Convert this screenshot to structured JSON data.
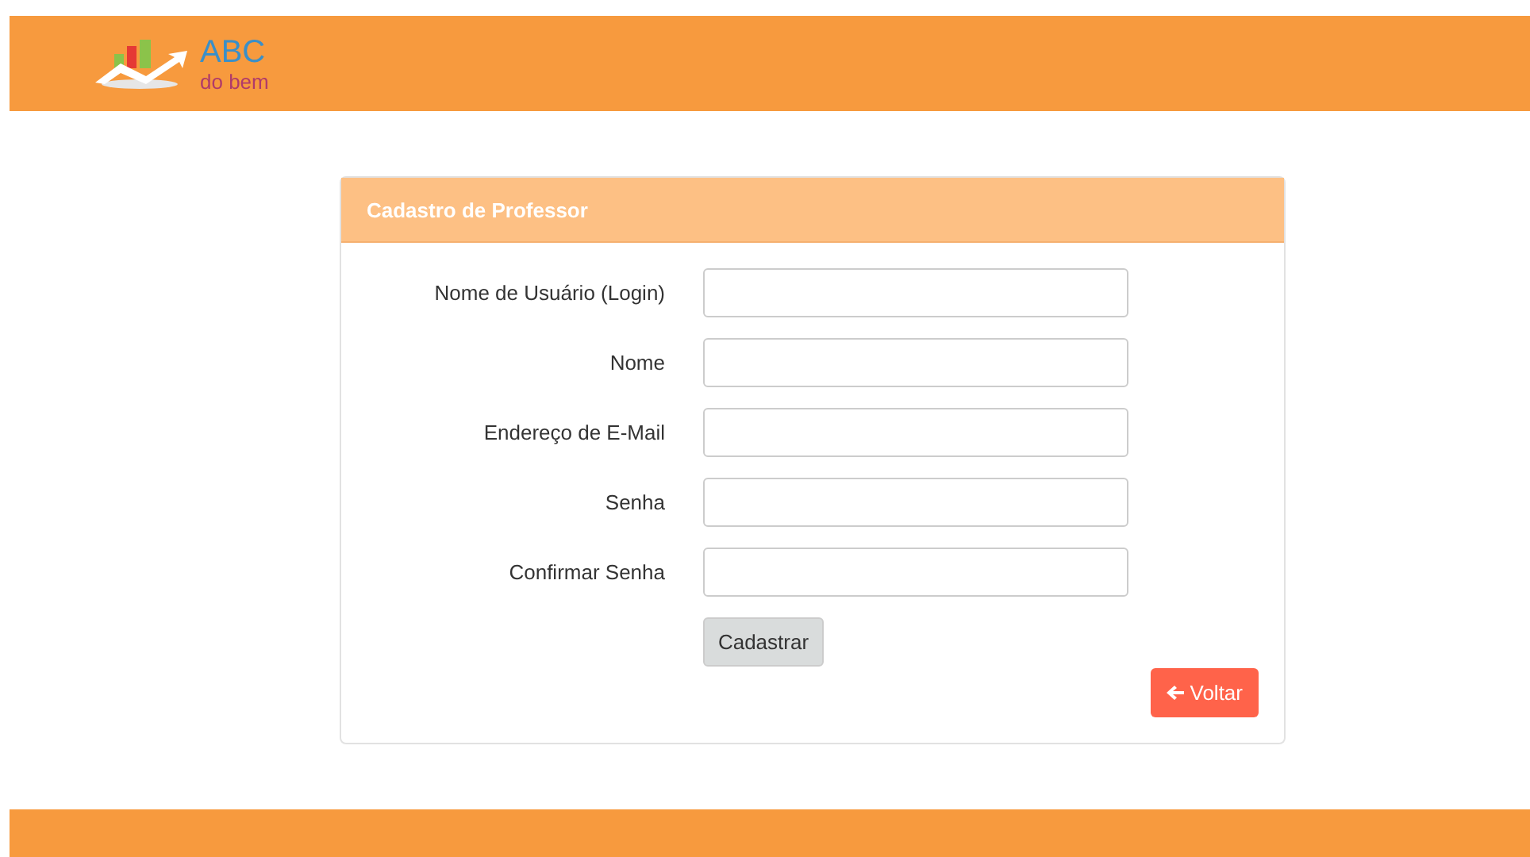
{
  "header": {
    "logo": {
      "title": "ABC",
      "subtitle": "do bem"
    }
  },
  "form": {
    "title": "Cadastro de Professor",
    "fields": [
      {
        "label": "Nome de Usuário (Login)"
      },
      {
        "label": "Nome"
      },
      {
        "label": "Endereço de E-Mail"
      },
      {
        "label": "Senha"
      },
      {
        "label": "Confirmar Senha"
      }
    ],
    "submit": "Cadastrar",
    "back": "Voltar"
  }
}
